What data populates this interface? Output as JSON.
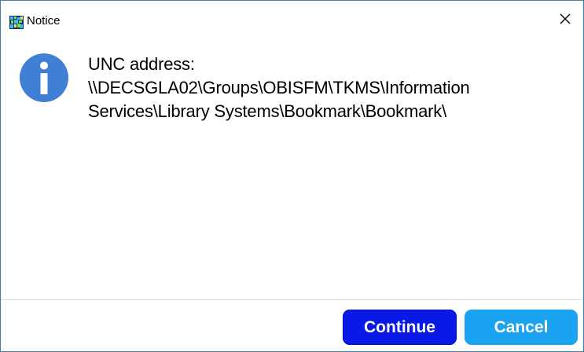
{
  "window": {
    "title": "Notice",
    "close_label": "×"
  },
  "message": {
    "line1": "UNC address:",
    "line2": "\\\\DECSGLA02\\Groups\\OBISFM\\TKMS\\Information",
    "line3": "Services\\Library Systems\\Bookmark\\Bookmark\\"
  },
  "buttons": {
    "continue_label": "Continue",
    "cancel_label": "Cancel"
  },
  "colors": {
    "info_icon": "#3f7fd6",
    "continue_bg": "#0a19e6",
    "cancel_bg": "#1aa3f0",
    "window_border": "#3c7fb1"
  },
  "icons": {
    "app": "app-icon",
    "info": "info-icon",
    "close": "close-icon"
  }
}
